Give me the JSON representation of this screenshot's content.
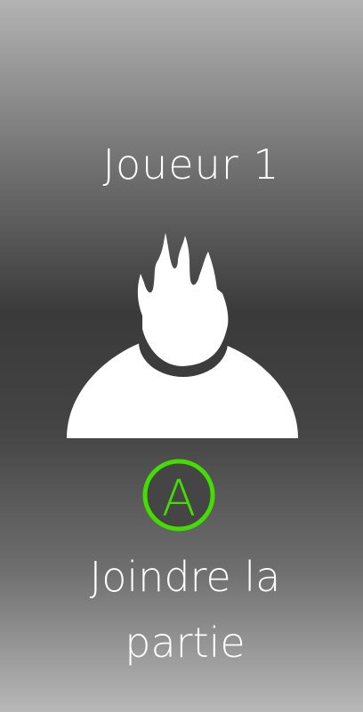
{
  "player_label": "Joueur 1",
  "button_glyph": "A",
  "join_line1": "Joindre la",
  "join_line2": "partie",
  "colors": {
    "button_ring": "#44dd00",
    "button_fill": "#454545"
  }
}
